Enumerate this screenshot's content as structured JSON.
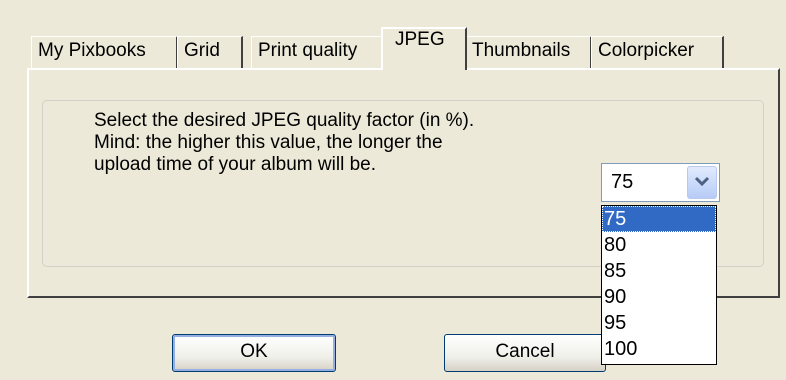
{
  "tabs": [
    {
      "label": "My Pixbooks",
      "active": false
    },
    {
      "label": "Grid",
      "active": false
    },
    {
      "label": "Print quality",
      "active": false
    },
    {
      "label": "JPEG",
      "active": true
    },
    {
      "label": "Thumbnails",
      "active": false
    },
    {
      "label": "Colorpicker",
      "active": false
    }
  ],
  "jpeg": {
    "description": [
      "Select the desired JPEG quality factor (in %).",
      "Mind: the higher this value, the longer the",
      "upload time of your album will be."
    ],
    "quality": {
      "selected": "75",
      "options": [
        "75",
        "80",
        "85",
        "90",
        "95",
        "100"
      ],
      "dropdown_open": true
    }
  },
  "buttons": {
    "ok": "OK",
    "cancel": "Cancel"
  },
  "colors": {
    "dialog_bg": "#ece9d8",
    "selection": "#316ac5",
    "button_border": "#003c74"
  },
  "icons": {
    "dropdown": "chevron-down-icon"
  }
}
